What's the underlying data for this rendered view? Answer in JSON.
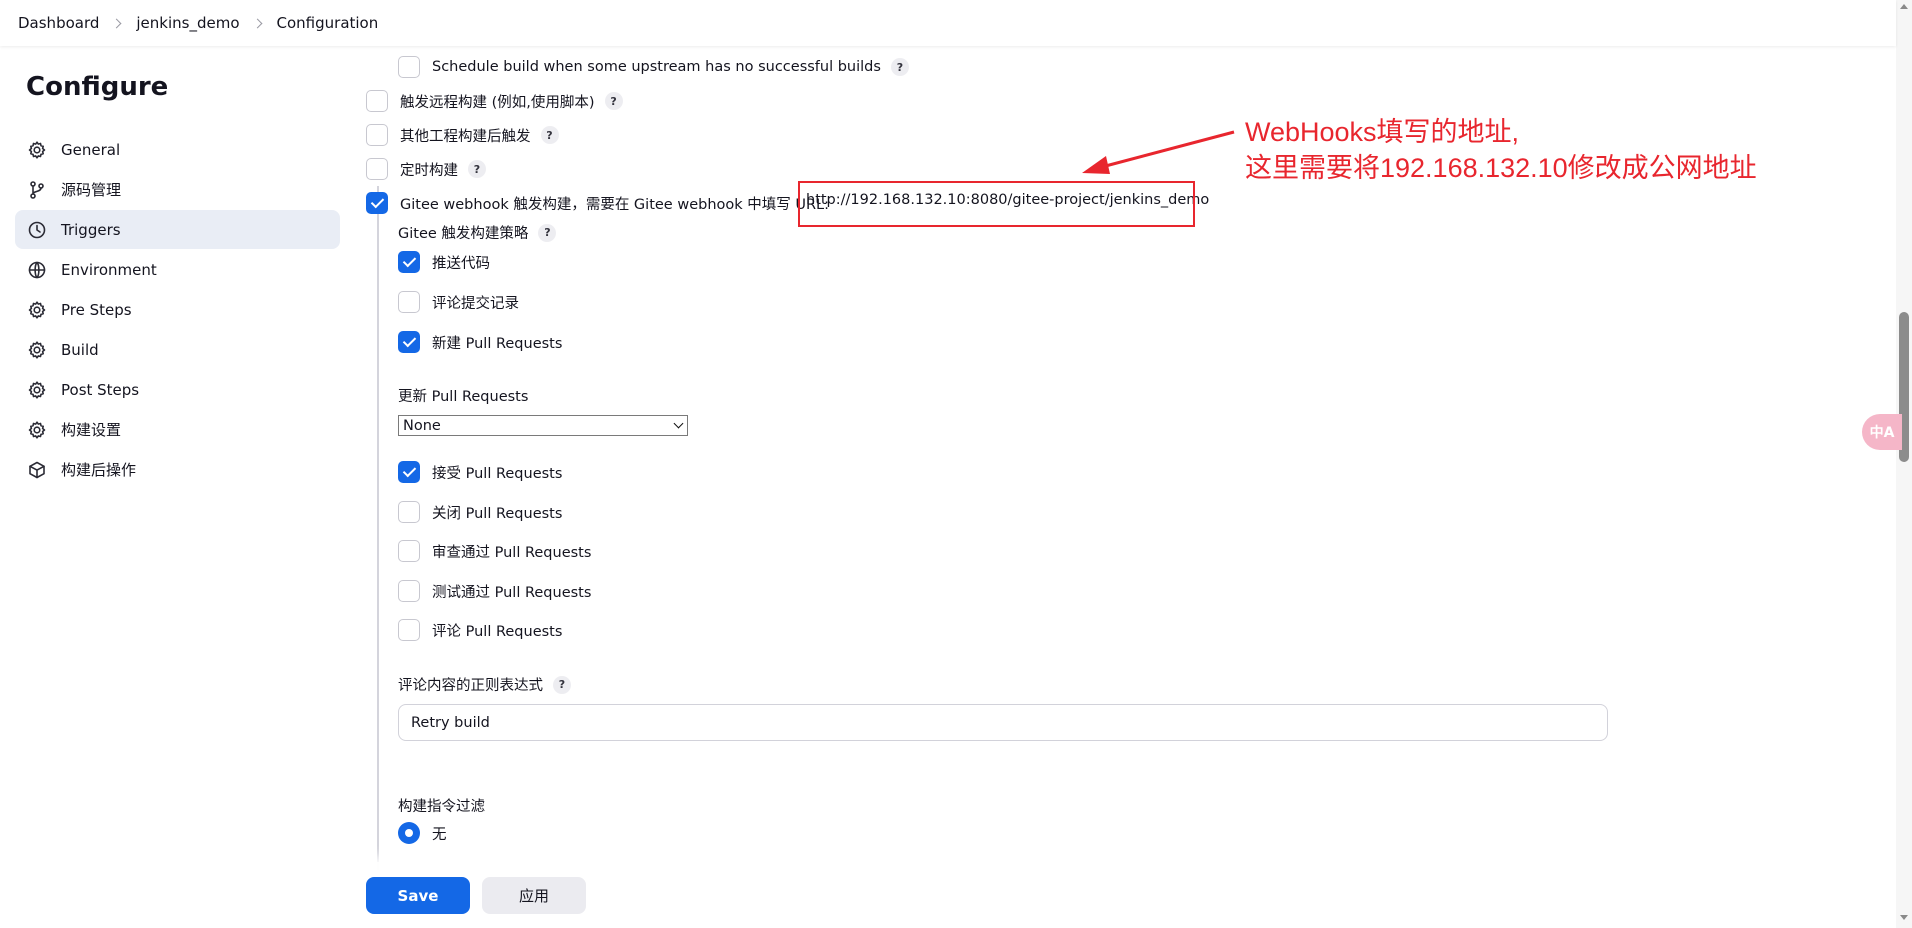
{
  "breadcrumb": [
    "Dashboard",
    "jenkins_demo",
    "Configuration"
  ],
  "sidebar": {
    "title": "Configure",
    "items": [
      {
        "label": "General",
        "icon": "gear-icon",
        "active": false
      },
      {
        "label": "源码管理",
        "icon": "branch-icon",
        "active": false
      },
      {
        "label": "Triggers",
        "icon": "clock-icon",
        "active": true
      },
      {
        "label": "Environment",
        "icon": "globe-icon",
        "active": false
      },
      {
        "label": "Pre Steps",
        "icon": "gear-icon",
        "active": false
      },
      {
        "label": "Build",
        "icon": "gear-icon",
        "active": false
      },
      {
        "label": "Post Steps",
        "icon": "gear-icon",
        "active": false
      },
      {
        "label": "构建设置",
        "icon": "gear-icon",
        "active": false
      },
      {
        "label": "构建后操作",
        "icon": "cube-icon",
        "active": false
      }
    ]
  },
  "triggers": {
    "schedule_no_success": {
      "label": "Schedule build when some upstream has no successful builds",
      "checked": false
    },
    "remote_trigger": {
      "label": "触发远程构建 (例如,使用脚本)",
      "checked": false
    },
    "after_other": {
      "label": "其他工程构建后触发",
      "checked": false
    },
    "timed": {
      "label": "定时构建",
      "checked": false
    },
    "gitee_webhook": {
      "label": "Gitee webhook 触发构建，需要在 Gitee webhook 中填写 URL:",
      "url": "http://192.168.132.10:8080/gitee-project/jenkins_demo",
      "checked": true
    }
  },
  "gitee": {
    "strategy_label": "Gitee 触发构建策略",
    "push_code": {
      "label": "推送代码",
      "checked": true
    },
    "comment_commit": {
      "label": "评论提交记录",
      "checked": false
    },
    "new_pr": {
      "label": "新建 Pull Requests",
      "checked": true
    },
    "update_pr_label": "更新 Pull Requests",
    "update_pr_value": "None",
    "accept_pr": {
      "label": "接受 Pull Requests",
      "checked": true
    },
    "close_pr": {
      "label": "关闭 Pull Requests",
      "checked": false
    },
    "review_pr": {
      "label": "审查通过 Pull Requests",
      "checked": false
    },
    "test_pr": {
      "label": "测试通过 Pull Requests",
      "checked": false
    },
    "comment_pr": {
      "label": "评论 Pull Requests",
      "checked": false
    },
    "regex_label": "评论内容的正则表达式",
    "regex_value": "Retry build",
    "filter_label": "构建指令过滤",
    "filter_none": "无"
  },
  "help_glyph": "?",
  "footer": {
    "save": "Save",
    "apply": "应用"
  },
  "annotation": {
    "line1": "WebHooks填写的地址,",
    "line2": "这里需要将192.168.132.10修改成公网地址",
    "color": "#e8262e"
  },
  "accent_color": "#1468e6",
  "translate_badge": "中A"
}
